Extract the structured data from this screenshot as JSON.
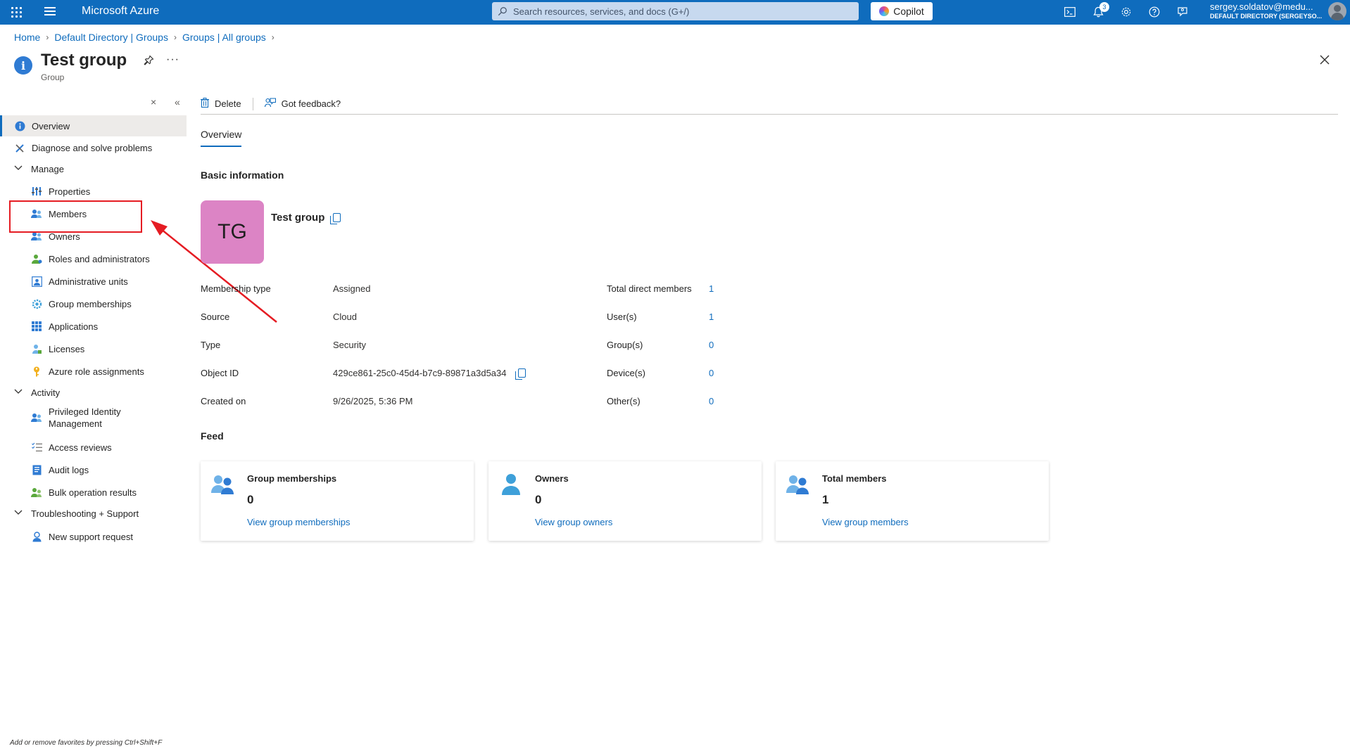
{
  "topbar": {
    "brand": "Microsoft Azure",
    "search_placeholder": "Search resources, services, and docs (G+/)",
    "copilot_label": "Copilot",
    "notification_count": "3",
    "user_email": "sergey.soldatov@medu...",
    "user_directory": "DEFAULT DIRECTORY (SERGEYSO..."
  },
  "breadcrumb": [
    "Home",
    "Default Directory | Groups",
    "Groups | All groups"
  ],
  "header": {
    "title": "Test group",
    "subtitle": "Group",
    "more": "···"
  },
  "sidebar": {
    "overview": "Overview",
    "diagnose": "Diagnose and solve problems",
    "manage": "Manage",
    "properties": "Properties",
    "members": "Members",
    "owners": "Owners",
    "roles": "Roles and administrators",
    "admin_units": "Administrative units",
    "group_memberships": "Group memberships",
    "applications": "Applications",
    "licenses": "Licenses",
    "azure_roles": "Azure role assignments",
    "activity": "Activity",
    "pim_line1": "Privileged Identity",
    "pim_line2": "Management",
    "access_reviews": "Access reviews",
    "audit_logs": "Audit logs",
    "bulk_ops": "Bulk operation results",
    "troubleshooting": "Troubleshooting + Support",
    "new_support": "New support request"
  },
  "hint": "Add or remove favorites by pressing Ctrl+Shift+F",
  "commands": {
    "delete": "Delete",
    "feedback": "Got feedback?"
  },
  "tab": "Overview",
  "basic": {
    "heading": "Basic information",
    "avatar_initials": "TG",
    "name": "Test group",
    "membership_type_label": "Membership type",
    "membership_type": "Assigned",
    "source_label": "Source",
    "source": "Cloud",
    "type_label": "Type",
    "type": "Security",
    "object_id_label": "Object ID",
    "object_id": "429ce861-25c0-45d4-b7c9-89871a3d5a34",
    "created_label": "Created on",
    "created": "9/26/2025, 5:36 PM",
    "total_direct_label": "Total direct members",
    "total_direct": "1",
    "users_label": "User(s)",
    "users": "1",
    "groups_label": "Group(s)",
    "groups": "0",
    "devices_label": "Device(s)",
    "devices": "0",
    "others_label": "Other(s)",
    "others": "0"
  },
  "feed": {
    "heading": "Feed",
    "cards": [
      {
        "title": "Group memberships",
        "value": "0",
        "link": "View group memberships"
      },
      {
        "title": "Owners",
        "value": "0",
        "link": "View group owners"
      },
      {
        "title": "Total members",
        "value": "1",
        "link": "View group members"
      }
    ]
  },
  "colors": {
    "azure_blue": "#0f6cbd",
    "avatar_pink": "#dc84c5",
    "highlight_red": "#e51c23"
  }
}
